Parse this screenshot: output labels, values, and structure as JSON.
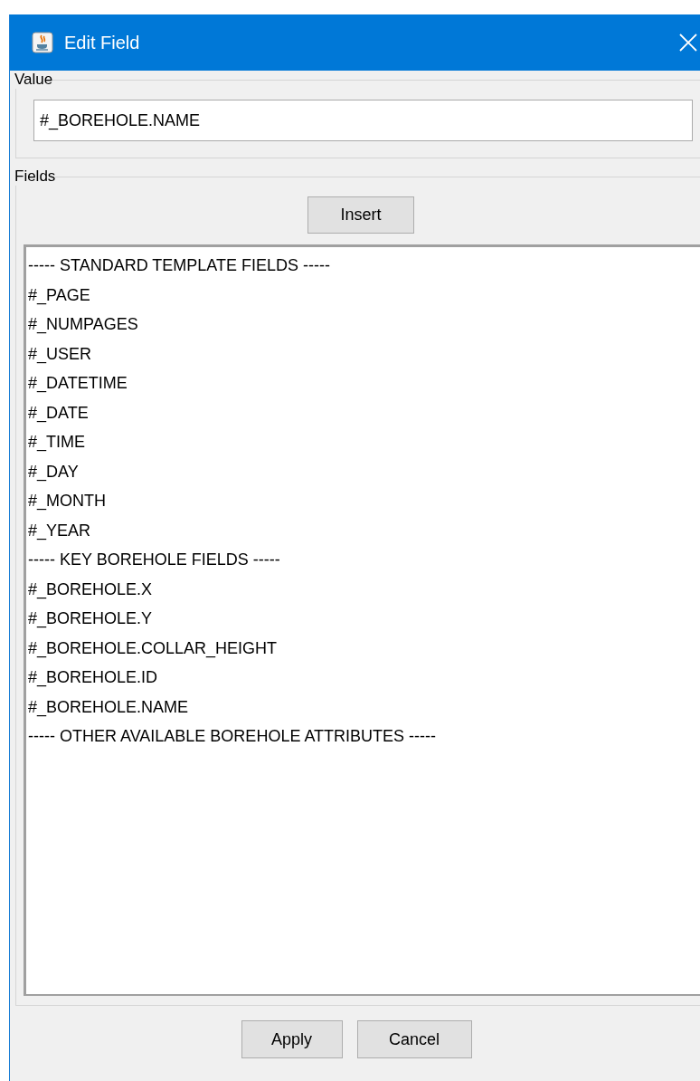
{
  "window": {
    "title": "Edit Field"
  },
  "value_group": {
    "legend": "Value",
    "value": "#_BOREHOLE.NAME"
  },
  "fields_group": {
    "legend": "Fields",
    "insert_button": "Insert",
    "items": [
      "----- STANDARD TEMPLATE FIELDS -----",
      "#_PAGE",
      "#_NUMPAGES",
      "#_USER",
      "#_DATETIME",
      "#_DATE",
      "#_TIME",
      "#_DAY",
      "#_MONTH",
      "#_YEAR",
      "----- KEY BOREHOLE FIELDS -----",
      "#_BOREHOLE.X",
      "#_BOREHOLE.Y",
      "#_BOREHOLE.COLLAR_HEIGHT",
      "#_BOREHOLE.ID",
      "#_BOREHOLE.NAME",
      "----- OTHER AVAILABLE BOREHOLE ATTRIBUTES -----"
    ]
  },
  "buttons": [
    "Apply",
    "Cancel"
  ]
}
